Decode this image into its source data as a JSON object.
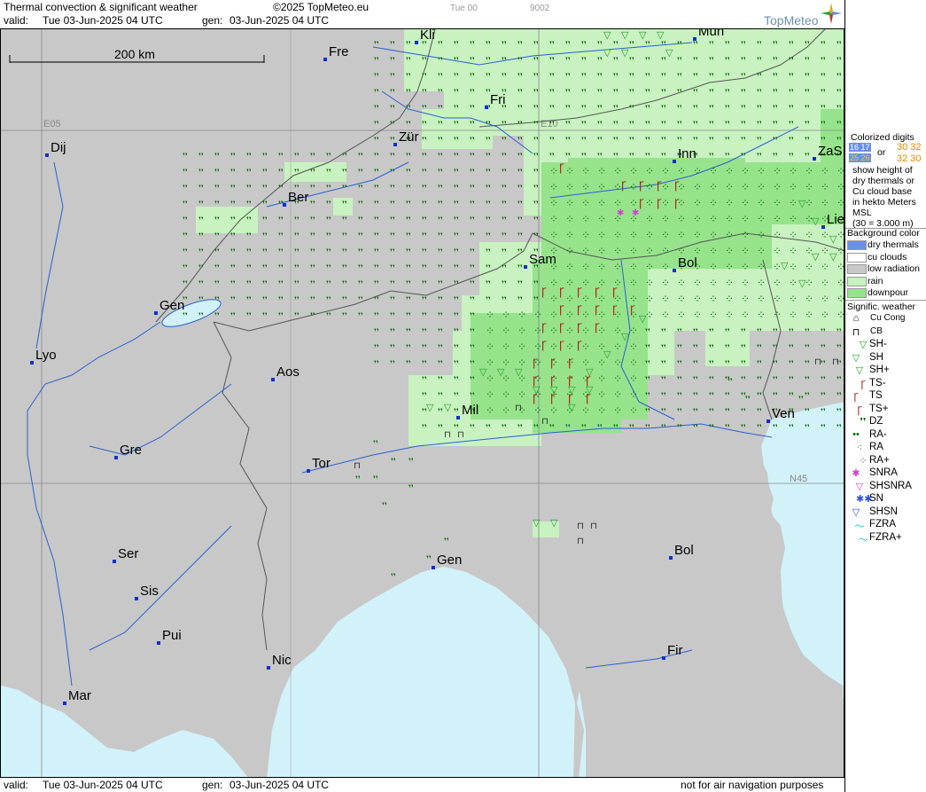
{
  "header": {
    "title": "Thermal convection & significant weather",
    "copyright": "©2025 TopMeteo.eu",
    "step": "Tue 00",
    "code": "9002",
    "valid_label": "valid:",
    "valid_value": "Tue   03-Jun-2025  04 UTC",
    "gen_label": "gen:",
    "gen_value": "03-Jun-2025 04 UTC",
    "brand": "TopMeteo"
  },
  "footer": {
    "valid_label": "valid:",
    "valid_value": "Tue   03-Jun-2025  04 UTC",
    "gen_label": "gen:",
    "gen_value": "03-Jun-2025 04 UTC",
    "notice": "not for air navigation purposes"
  },
  "map": {
    "scale_label": "200 km",
    "colors": {
      "land": "#c8c8c8",
      "sea": "#d2f2fa",
      "rain": "#c8f2c0",
      "downpour": "#96e38c",
      "drizzle_mark": "#0a6a0a",
      "shower_mark": "#22a022",
      "storm_mark": "#b41414",
      "river": "#2a5fd0",
      "border": "#606060",
      "city": "#1030d0"
    },
    "grid_labels": [
      {
        "id": "e05",
        "text": "E05"
      },
      {
        "id": "e10",
        "text": "E10"
      },
      {
        "id": "n45",
        "text": "N45"
      }
    ],
    "cities": [
      {
        "id": "kli",
        "name": "Kli"
      },
      {
        "id": "mun",
        "name": "Mun"
      },
      {
        "id": "fre",
        "name": "Fre"
      },
      {
        "id": "fri",
        "name": "Fri"
      },
      {
        "id": "dij",
        "name": "Dij"
      },
      {
        "id": "zur",
        "name": "Zür"
      },
      {
        "id": "inn",
        "name": "Inn"
      },
      {
        "id": "zas",
        "name": "ZaS"
      },
      {
        "id": "ber",
        "name": "Ber"
      },
      {
        "id": "lie",
        "name": "Lie"
      },
      {
        "id": "sam",
        "name": "Sam"
      },
      {
        "id": "bol1",
        "name": "Bol"
      },
      {
        "id": "gen1",
        "name": "Gen"
      },
      {
        "id": "lyo",
        "name": "Lyo"
      },
      {
        "id": "aos",
        "name": "Aos"
      },
      {
        "id": "mil",
        "name": "Mil"
      },
      {
        "id": "ven",
        "name": "Ven"
      },
      {
        "id": "gre",
        "name": "Gre"
      },
      {
        "id": "tor",
        "name": "Tor"
      },
      {
        "id": "ser",
        "name": "Ser"
      },
      {
        "id": "bol2",
        "name": "Bol"
      },
      {
        "id": "gen2",
        "name": "Gen"
      },
      {
        "id": "sis",
        "name": "Sis"
      },
      {
        "id": "pui",
        "name": "Pui"
      },
      {
        "id": "nic",
        "name": "Nic"
      },
      {
        "id": "fir",
        "name": "Fir"
      },
      {
        "id": "mar",
        "name": "Mar"
      }
    ]
  },
  "legend": {
    "colorized_title": "Colorized digits",
    "digits_a": "16 17",
    "digits_b": "25 26",
    "digits_or": "or",
    "digits_c": "30 32",
    "digits_d": "32 30",
    "explain": [
      "show height of",
      "dry thermals or",
      "Cu cloud base",
      "in hekto Meters",
      "MSL",
      "(30 = 3.000 m)"
    ],
    "bg_title": "Background color",
    "bg_items": [
      {
        "label": "dry thermals",
        "color": "#6b8fe8"
      },
      {
        "label": "cu clouds",
        "color": "#ffffff"
      },
      {
        "label": "low radiation",
        "color": "#c8c8c8"
      },
      {
        "label": "rain",
        "color": "#c8f2c0"
      },
      {
        "label": "downpour",
        "color": "#96e38c"
      }
    ],
    "sig_title": "Signific. weather",
    "sig_items": [
      {
        "label": "Cu Cong",
        "glyph": "⌂",
        "color": "#000000"
      },
      {
        "label": "CB",
        "glyph": "⊓",
        "color": "#000000"
      },
      {
        "label": "SH-",
        "glyph": "▽",
        "color": "#22a022"
      },
      {
        "label": "SH",
        "glyph": "▽",
        "color": "#22a022"
      },
      {
        "label": "SH+",
        "glyph": "▽",
        "color": "#22a022"
      },
      {
        "label": "TS-",
        "glyph": "Ꞅ",
        "color": "#b41414"
      },
      {
        "label": "TS",
        "glyph": "Ꞅ",
        "color": "#b41414"
      },
      {
        "label": "TS+",
        "glyph": "Ꞅ",
        "color": "#b41414"
      },
      {
        "label": "DZ",
        "glyph": "❜❜",
        "color": "#0a6a0a"
      },
      {
        "label": "RA-",
        "glyph": "••",
        "color": "#0a6a0a"
      },
      {
        "label": "RA",
        "glyph": "⁖",
        "color": "#0a6a0a"
      },
      {
        "label": "RA+",
        "glyph": "⁘",
        "color": "#0a6a0a"
      },
      {
        "label": "SNRA",
        "glyph": "✱",
        "color": "#d040d0"
      },
      {
        "label": "SHSNRA",
        "glyph": "▽",
        "color": "#d040d0"
      },
      {
        "label": "SN",
        "glyph": "✱✱",
        "color": "#3050e0"
      },
      {
        "label": "SHSN",
        "glyph": "▽",
        "color": "#3050e0"
      },
      {
        "label": "FZRA",
        "glyph": "〜",
        "color": "#20c0e0"
      },
      {
        "label": "FZRA+",
        "glyph": "〜",
        "color": "#20c0e0"
      }
    ]
  }
}
